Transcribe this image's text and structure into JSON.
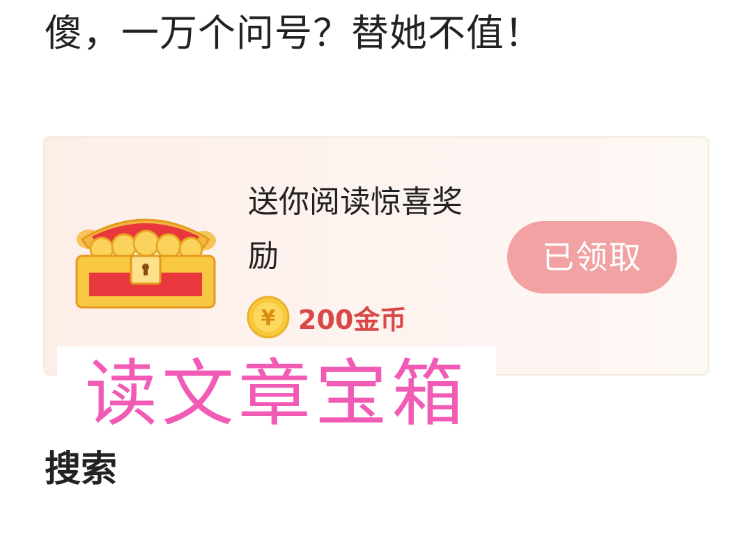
{
  "article": {
    "text_line": "傻，一万个问号？替她不值！"
  },
  "reward_card": {
    "title": "送你阅读惊喜奖励",
    "coin_amount": "200金币",
    "coin_icon_symbol": "¥",
    "claim_button_label": "已领取",
    "colors": {
      "button_bg": "#f2a2a2",
      "coin_text": "#d94848"
    }
  },
  "overlay_caption": {
    "text": "读文章宝箱",
    "color": "#f15bb5"
  },
  "section": {
    "heading": "搜索"
  }
}
